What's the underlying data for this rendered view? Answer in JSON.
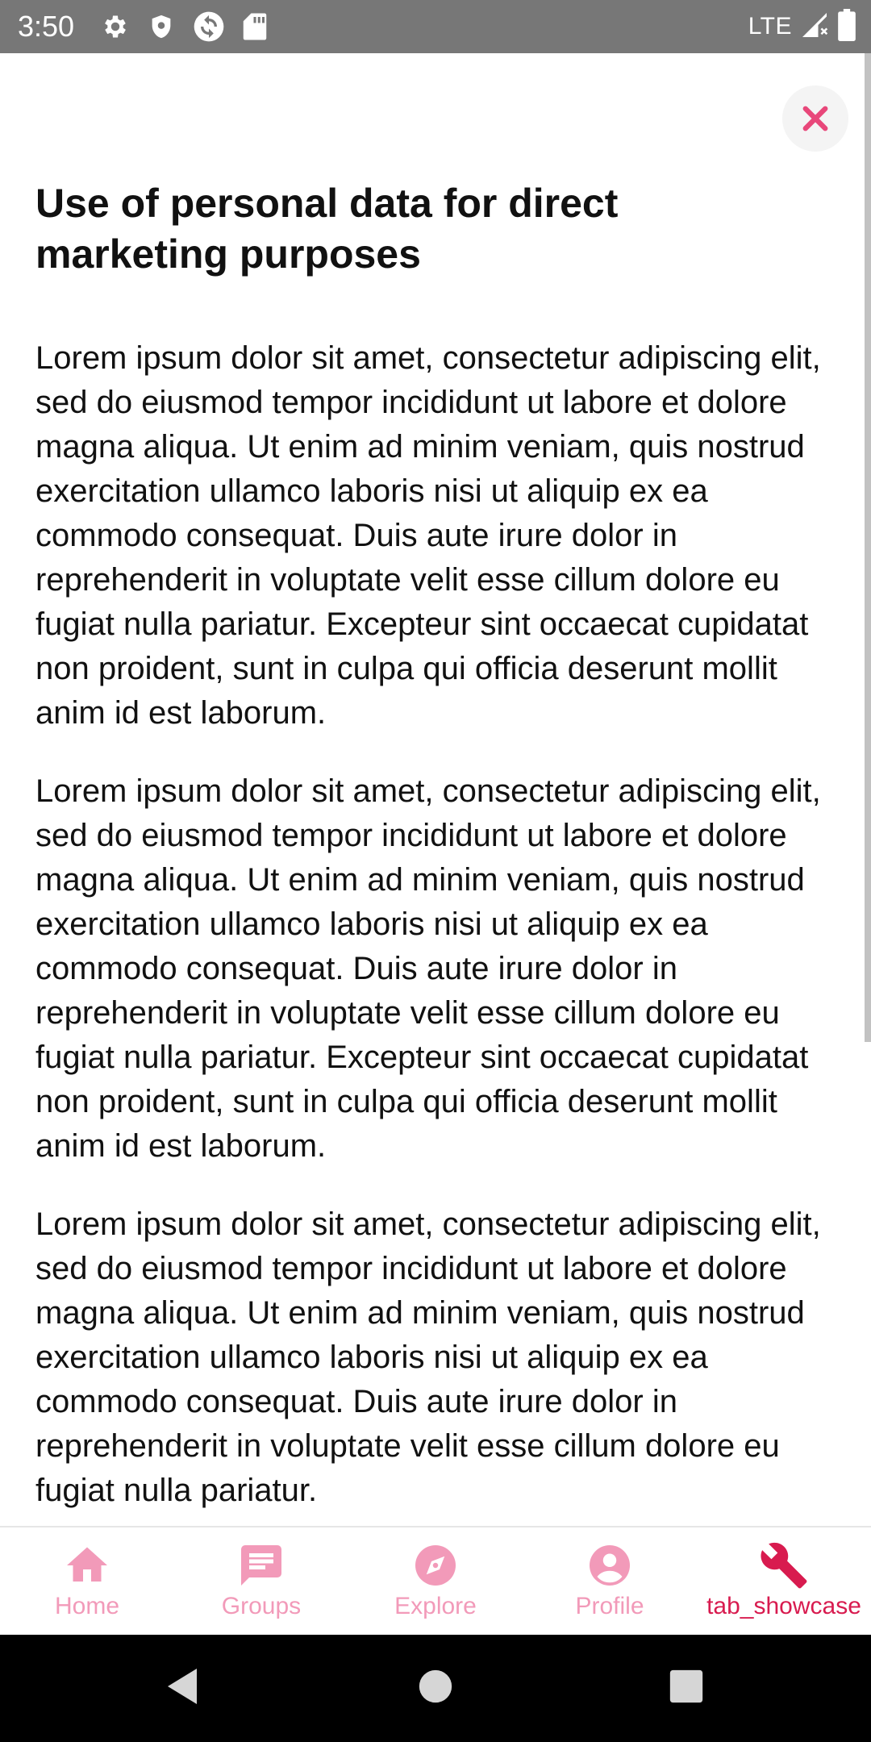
{
  "status_bar": {
    "time": "3:50",
    "network": "LTE",
    "icons": [
      "settings-gear-icon",
      "shield-icon",
      "sync-icon",
      "sd-card-icon",
      "signal-icon",
      "battery-icon"
    ]
  },
  "dialog": {
    "close_icon": "close-x-icon",
    "title": "Use of personal data for direct marketing purposes",
    "paragraphs": [
      "Lorem ipsum dolor sit amet, consectetur adipiscing elit, sed do eiusmod tempor incididunt ut labore et dolore magna aliqua. Ut enim ad minim veniam, quis nostrud exercitation ullamco laboris nisi ut aliquip ex ea commodo consequat. Duis aute irure dolor in reprehenderit in voluptate velit esse cillum dolore eu fugiat nulla pariatur. Excepteur sint occaecat cupidatat non proident, sunt in culpa qui officia deserunt mollit anim id est laborum.",
      "Lorem ipsum dolor sit amet, consectetur adipiscing elit, sed do eiusmod tempor incididunt ut labore et dolore magna aliqua. Ut enim ad minim veniam, quis nostrud exercitation ullamco laboris nisi ut aliquip ex ea commodo consequat. Duis aute irure dolor in reprehenderit in voluptate velit esse cillum dolore eu fugiat nulla pariatur. Excepteur sint occaecat cupidatat non proident, sunt in culpa qui officia deserunt mollit anim id est laborum.",
      "Lorem ipsum dolor sit amet, consectetur adipiscing elit, sed do eiusmod tempor incididunt ut labore et dolore magna aliqua. Ut enim ad minim veniam, quis nostrud exercitation ullamco laboris nisi ut aliquip ex ea commodo consequat. Duis aute irure dolor in reprehenderit in voluptate velit esse cillum dolore eu fugiat nulla pariatur."
    ]
  },
  "bottom_nav": {
    "items": [
      {
        "label": "Home",
        "icon": "home-icon",
        "active": false
      },
      {
        "label": "Groups",
        "icon": "chat-icon",
        "active": false
      },
      {
        "label": "Explore",
        "icon": "compass-icon",
        "active": false
      },
      {
        "label": "Profile",
        "icon": "account-icon",
        "active": false
      },
      {
        "label": "tab_showcase",
        "icon": "wrench-icon",
        "active": true
      }
    ]
  },
  "colors": {
    "accent": "#d81b4f",
    "accent_inactive": "#f29ab9",
    "status_bar": "#777777",
    "close_icon": "#e8477a"
  },
  "system_nav": {
    "buttons": [
      "back-icon",
      "home-circle-icon",
      "recents-icon"
    ]
  }
}
